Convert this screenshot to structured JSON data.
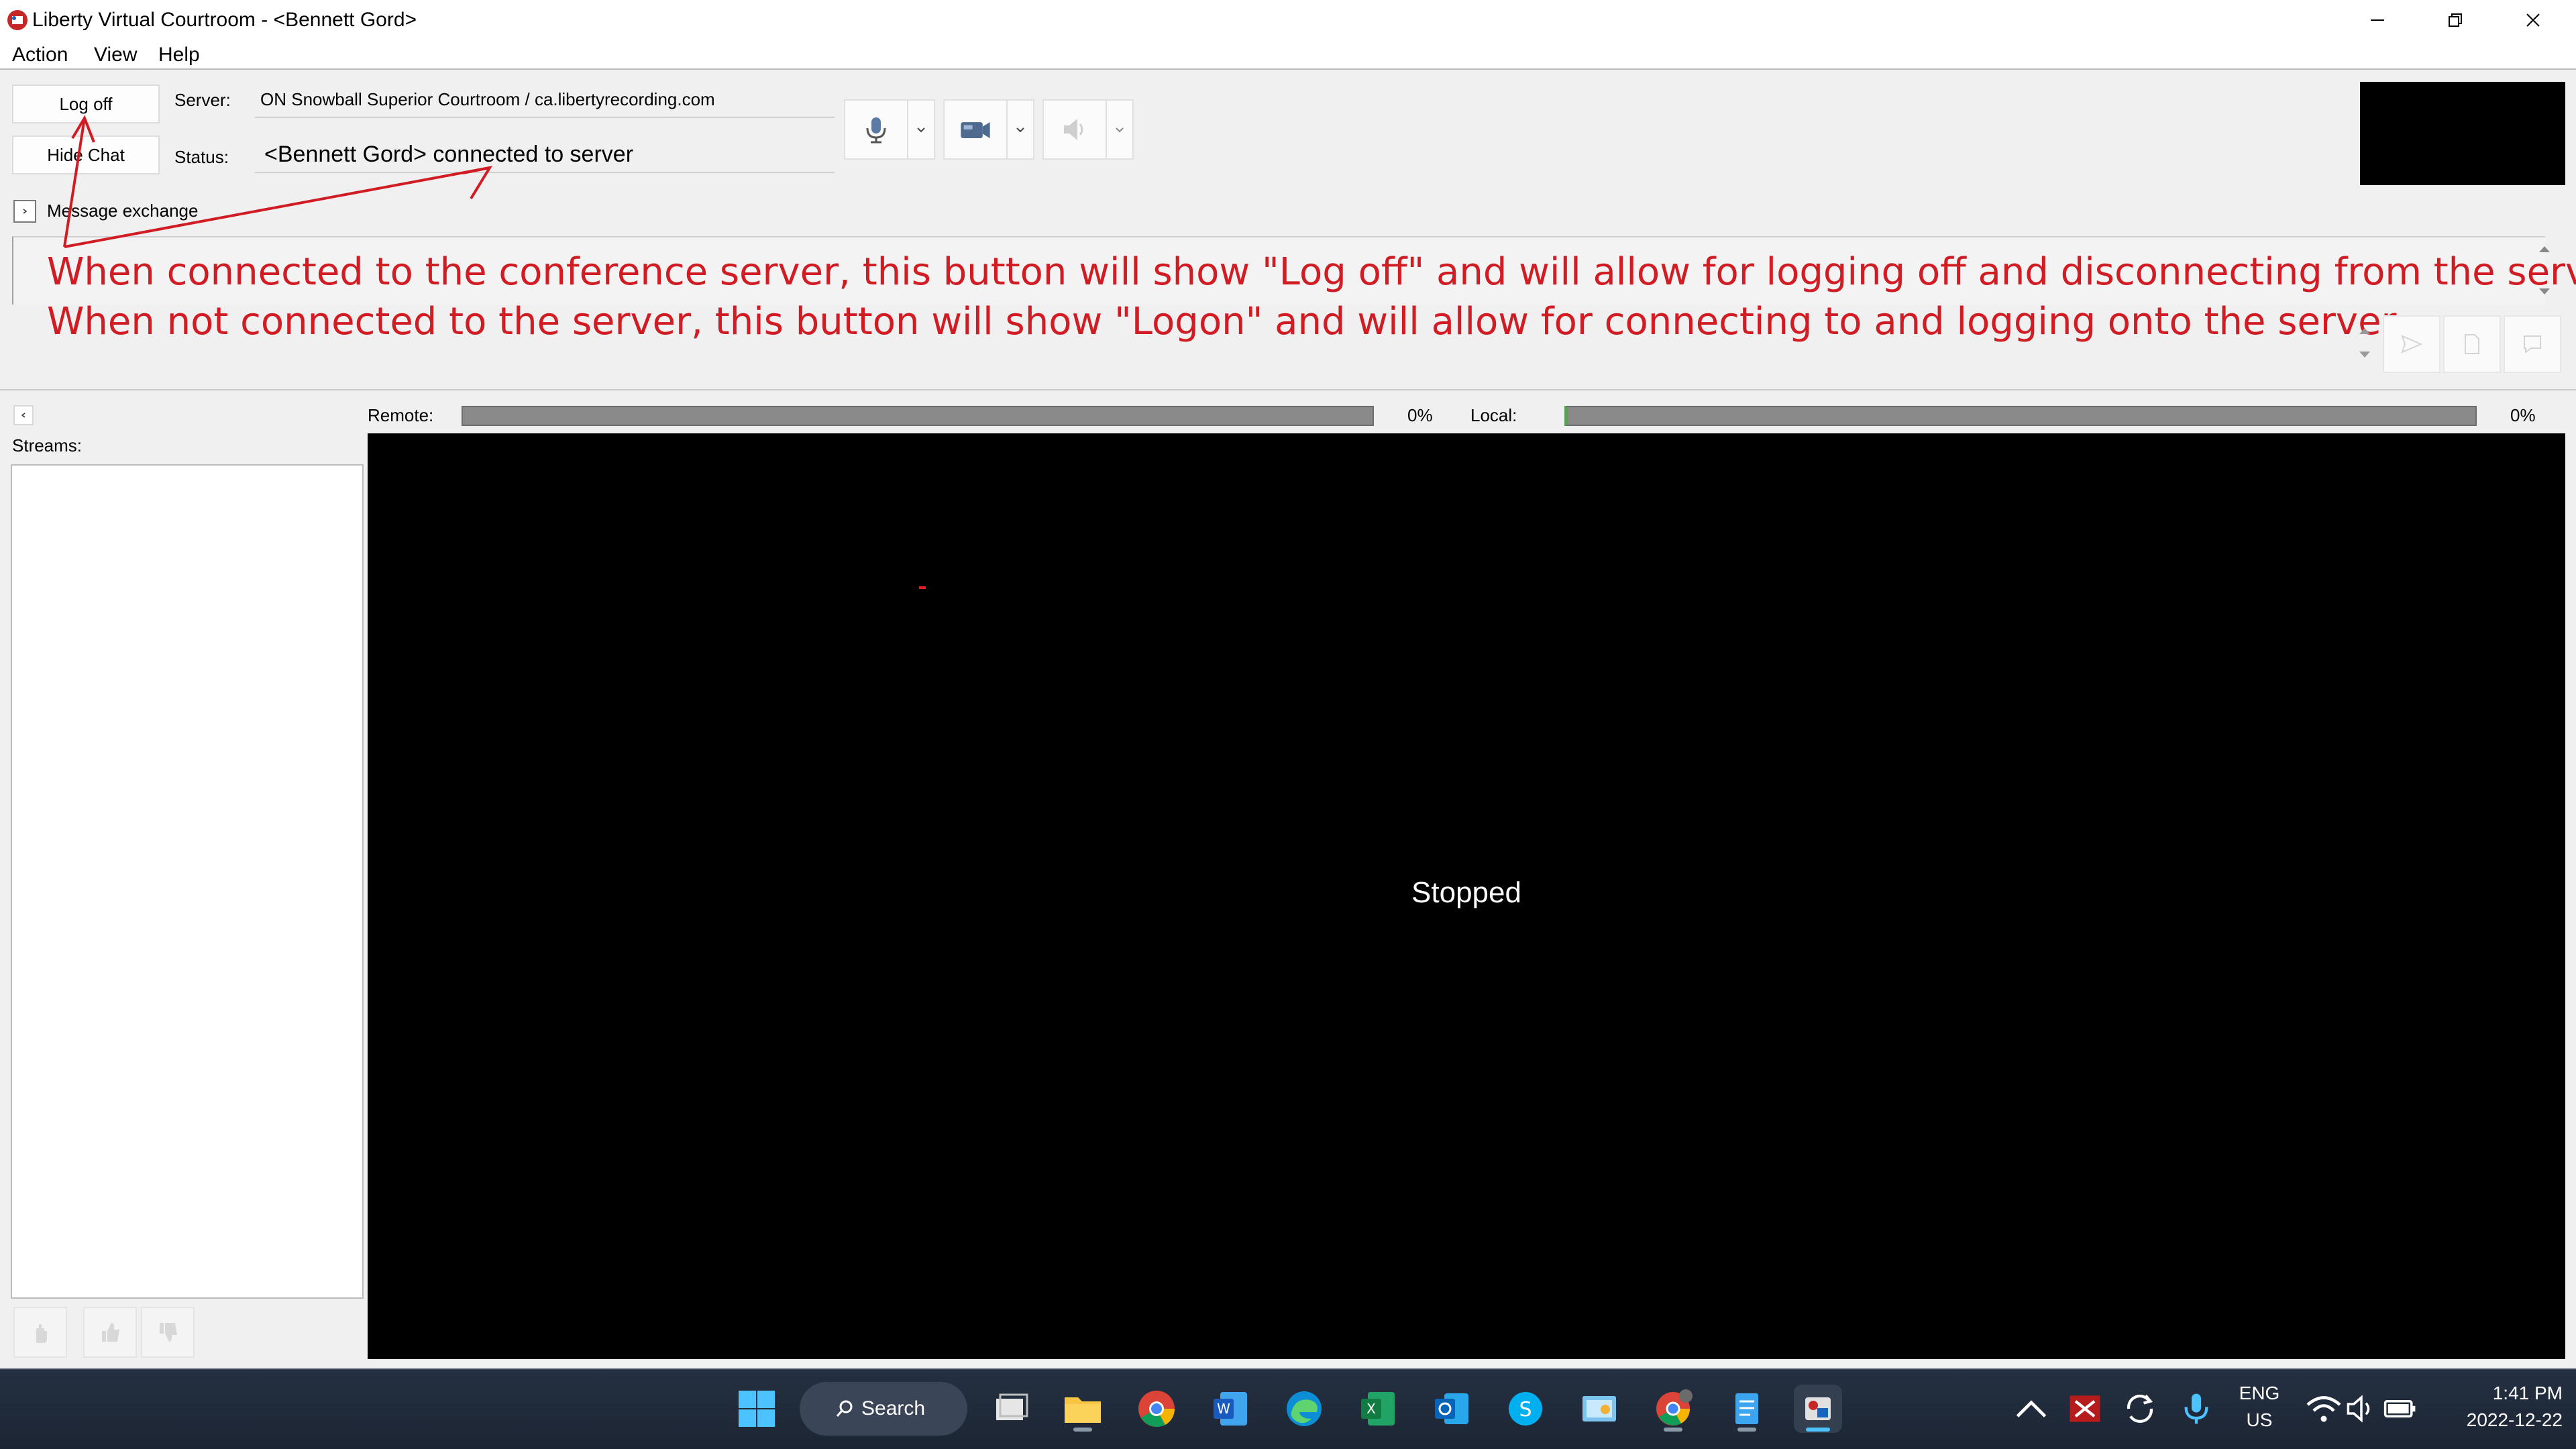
{
  "window": {
    "title": "Liberty Virtual Courtroom - <Bennett Gord>",
    "controls": [
      "minimize-icon",
      "restore-icon",
      "close-icon"
    ]
  },
  "menu": {
    "items": [
      "Action",
      "View",
      "Help"
    ]
  },
  "connection": {
    "logoff_label": "Log off",
    "hidechat_label": "Hide Chat",
    "server_label": "Server:",
    "server_value": "ON Snowball Superior Courtroom / ca.libertyrecording.com",
    "status_label": "Status:",
    "status_value": "<Bennett Gord> connected to server"
  },
  "toolbar": {
    "icons": [
      "microphone-icon",
      "camera-icon",
      "speaker-icon"
    ]
  },
  "chat": {
    "message_exchange_label": "Message exchange",
    "annotation_line1": "When connected to the conference server, this button will show  \"Log off\"  and will allow for logging off and disconnecting from the server.",
    "annotation_line2": "When not connected to the server, this button will show  \"Logon\"  and will allow for connecting to and logging onto the server."
  },
  "streams": {
    "label": "Streams:"
  },
  "levels": {
    "remote_label": "Remote:",
    "remote_value": "0%",
    "remote_percent": 0,
    "local_label": "Local:",
    "local_value": "0%",
    "local_percent": 0
  },
  "video": {
    "status": "Stopped"
  },
  "taskbar": {
    "search_label": "Search",
    "language": "ENG",
    "region": "US",
    "time": "1:41 PM",
    "date": "2022-12-22"
  },
  "colors": {
    "annotation": "#d11c24",
    "video_bg": "#000000",
    "taskbar_bg": "#1f2937"
  }
}
